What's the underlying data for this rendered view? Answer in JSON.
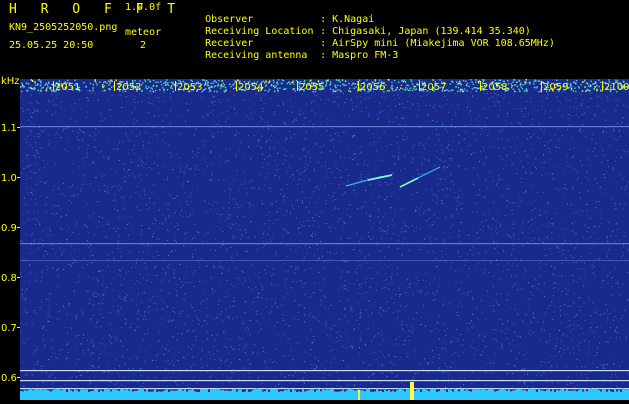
{
  "header": {
    "app_title": "H R O F F T",
    "version": "1.0.0f",
    "filename": "KN9_2505252050.png",
    "meteor_label": "meteor",
    "datetime": "25.05.25 20:50",
    "meteor_count": "2",
    "info": [
      {
        "label": "Observer",
        "value": "K.Nagai"
      },
      {
        "label": "Receiving Location",
        "value": "Chigasaki, Japan (139.414 35.340)"
      },
      {
        "label": "Receiver",
        "value": "AirSpy mini (Miakejima VOR 108.65MHz)"
      },
      {
        "label": "Receiving antenna",
        "value": "Maspro FM-3"
      }
    ],
    "separator": ":"
  },
  "spectrogram": {
    "freq_unit": "kHz",
    "freq_ticks": [
      "1.1",
      "1.0",
      "0.9",
      "0.8",
      "0.7",
      "0.6"
    ],
    "time_ticks": [
      "2051",
      "2052",
      "2053",
      "2054",
      "2055",
      "2056",
      "2057",
      "2058",
      "2059",
      "2100"
    ],
    "colors": {
      "background": "#1a2a8c",
      "noise": "#3c78e0",
      "top_band": "#5fc8ff",
      "hot": "#ffff40",
      "bottom_band": "#2ec8ff",
      "text": "#ffff00"
    }
  }
}
